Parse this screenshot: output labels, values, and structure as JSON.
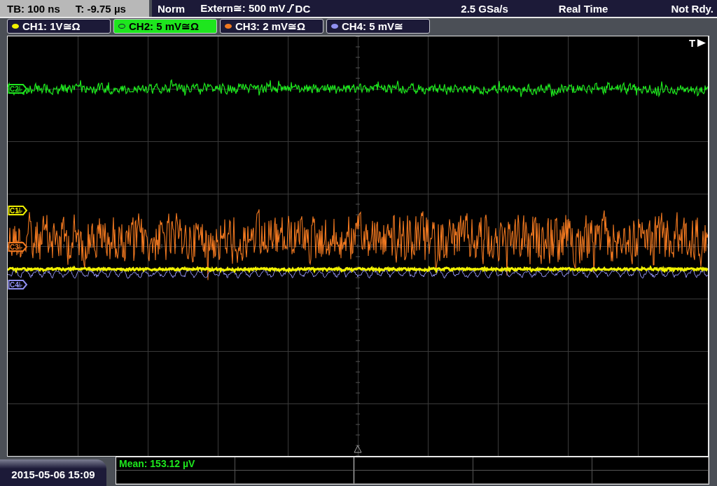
{
  "header": {
    "timebase": "TB: 100 ns",
    "trigger_time": "T: -9.75 µs",
    "mode": "Norm",
    "trigger_source": "Extern≅: 500 mV",
    "coupling": "DC",
    "sample_rate": "2.5 GSa/s",
    "acquisition": "Real Time",
    "status": "Not Rdy."
  },
  "channels": [
    {
      "label": "CH1: 1V≅Ω",
      "color": "#f0f000",
      "selected": false
    },
    {
      "label": "CH2: 5 mV≅Ω",
      "color": "#1ee61e",
      "selected": true
    },
    {
      "label": "CH3: 2 mV≅Ω",
      "color": "#f07820",
      "selected": false
    },
    {
      "label": "CH4: 5 mV≅",
      "color": "#9090f0",
      "selected": false
    }
  ],
  "markers": [
    {
      "label": "C2",
      "color": "#1ee61e"
    },
    {
      "label": "C1",
      "color": "#f0f000"
    },
    {
      "label": "C3",
      "color": "#f07820"
    },
    {
      "label": "C4",
      "color": "#9090f0"
    }
  ],
  "trigger_label": "T",
  "measurement": "Mean: 153.12 µV",
  "date": "2015-05-06 15:09"
}
